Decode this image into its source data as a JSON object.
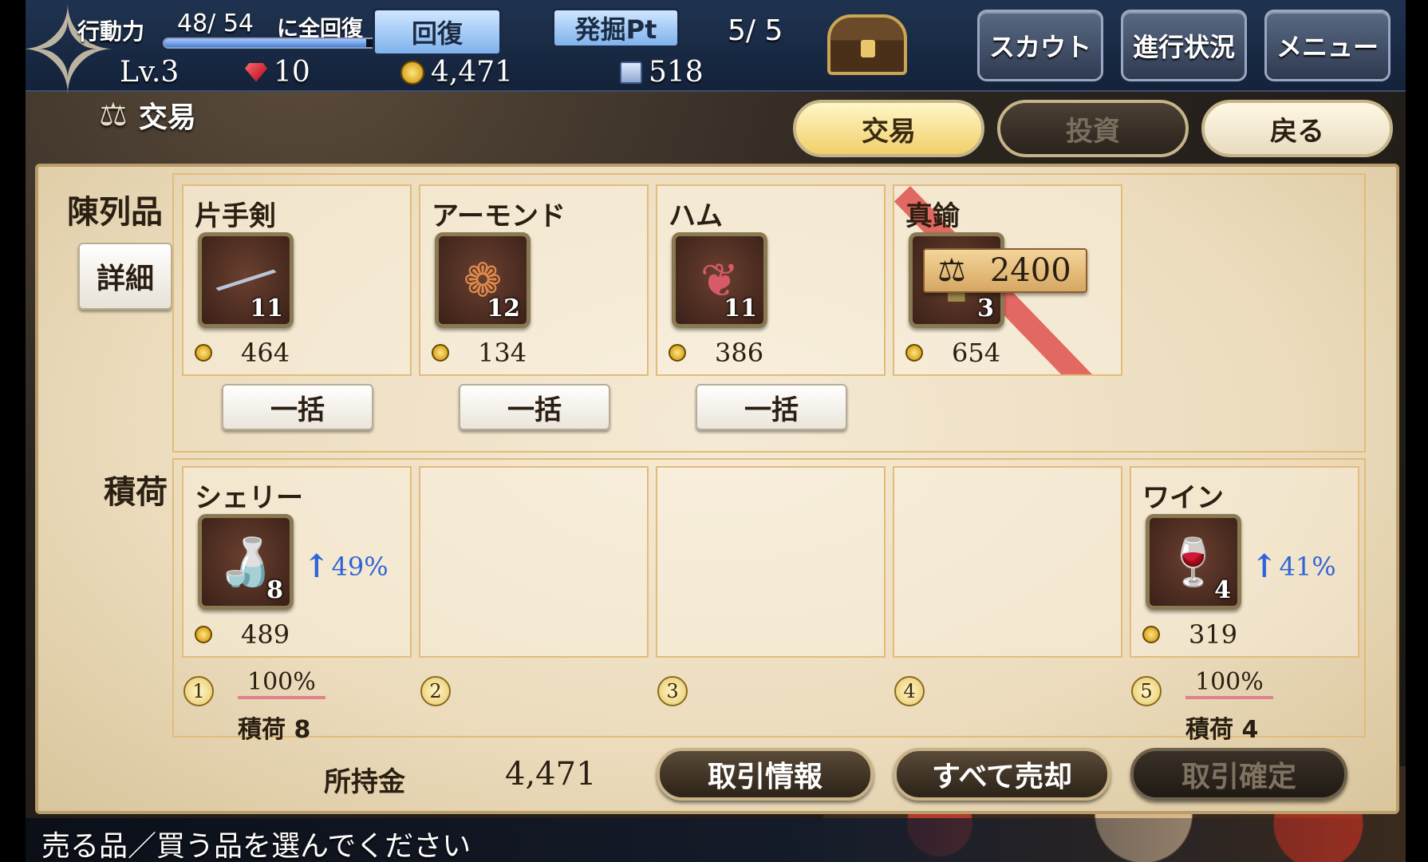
{
  "topbar": {
    "stamina_label": "行動力",
    "stamina_value": "48/ 54",
    "stamina_suffix": "に全回復",
    "stamina_fraction": 0.89,
    "recover_label": "回復",
    "excavate_label": "発掘Pt",
    "excavate_value": "5/ 5",
    "level": "Lv.3",
    "gems": "10",
    "gold": "4,471",
    "cards": "518",
    "scout_label": "スカウト",
    "progress_label": "進行状況",
    "menu_label": "メニュー"
  },
  "header": {
    "title": "交易",
    "tab_trade": "交易",
    "tab_invest": "投資",
    "back_label": "戻る"
  },
  "display": {
    "label": "陳列品",
    "detail_label": "詳細",
    "bulk_label": "一括",
    "items": [
      {
        "name": "片手剣",
        "count": "11",
        "price": "464",
        "icon": "sword-icon"
      },
      {
        "name": "アーモンド",
        "count": "12",
        "price": "134",
        "icon": "almond-icon"
      },
      {
        "name": "ハム",
        "count": "11",
        "price": "386",
        "icon": "ham-icon"
      },
      {
        "name": "真鍮",
        "count": "3",
        "price": "654",
        "icon": "brass-icon",
        "tag_value": "2400",
        "tag_icon": "scale-icon"
      }
    ]
  },
  "cargo": {
    "label": "積荷",
    "slots": [
      {
        "num": "1",
        "name": "シェリー",
        "count": "8",
        "price": "489",
        "rise": "49%",
        "percent": "100%",
        "cargo_text": "積荷 8",
        "icon": "sherry-icon"
      },
      {
        "num": "2"
      },
      {
        "num": "3"
      },
      {
        "num": "4"
      },
      {
        "num": "5",
        "name": "ワイン",
        "count": "4",
        "price": "319",
        "rise": "41%",
        "percent": "100%",
        "cargo_text": "積荷 4",
        "icon": "wine-icon"
      }
    ]
  },
  "footer": {
    "money_label": "所持金",
    "money_value": "4,471",
    "info_label": "取引情報",
    "sell_all_label": "すべて売却",
    "confirm_label": "取引確定",
    "status_message": "売る品／買う品を選んでください"
  }
}
